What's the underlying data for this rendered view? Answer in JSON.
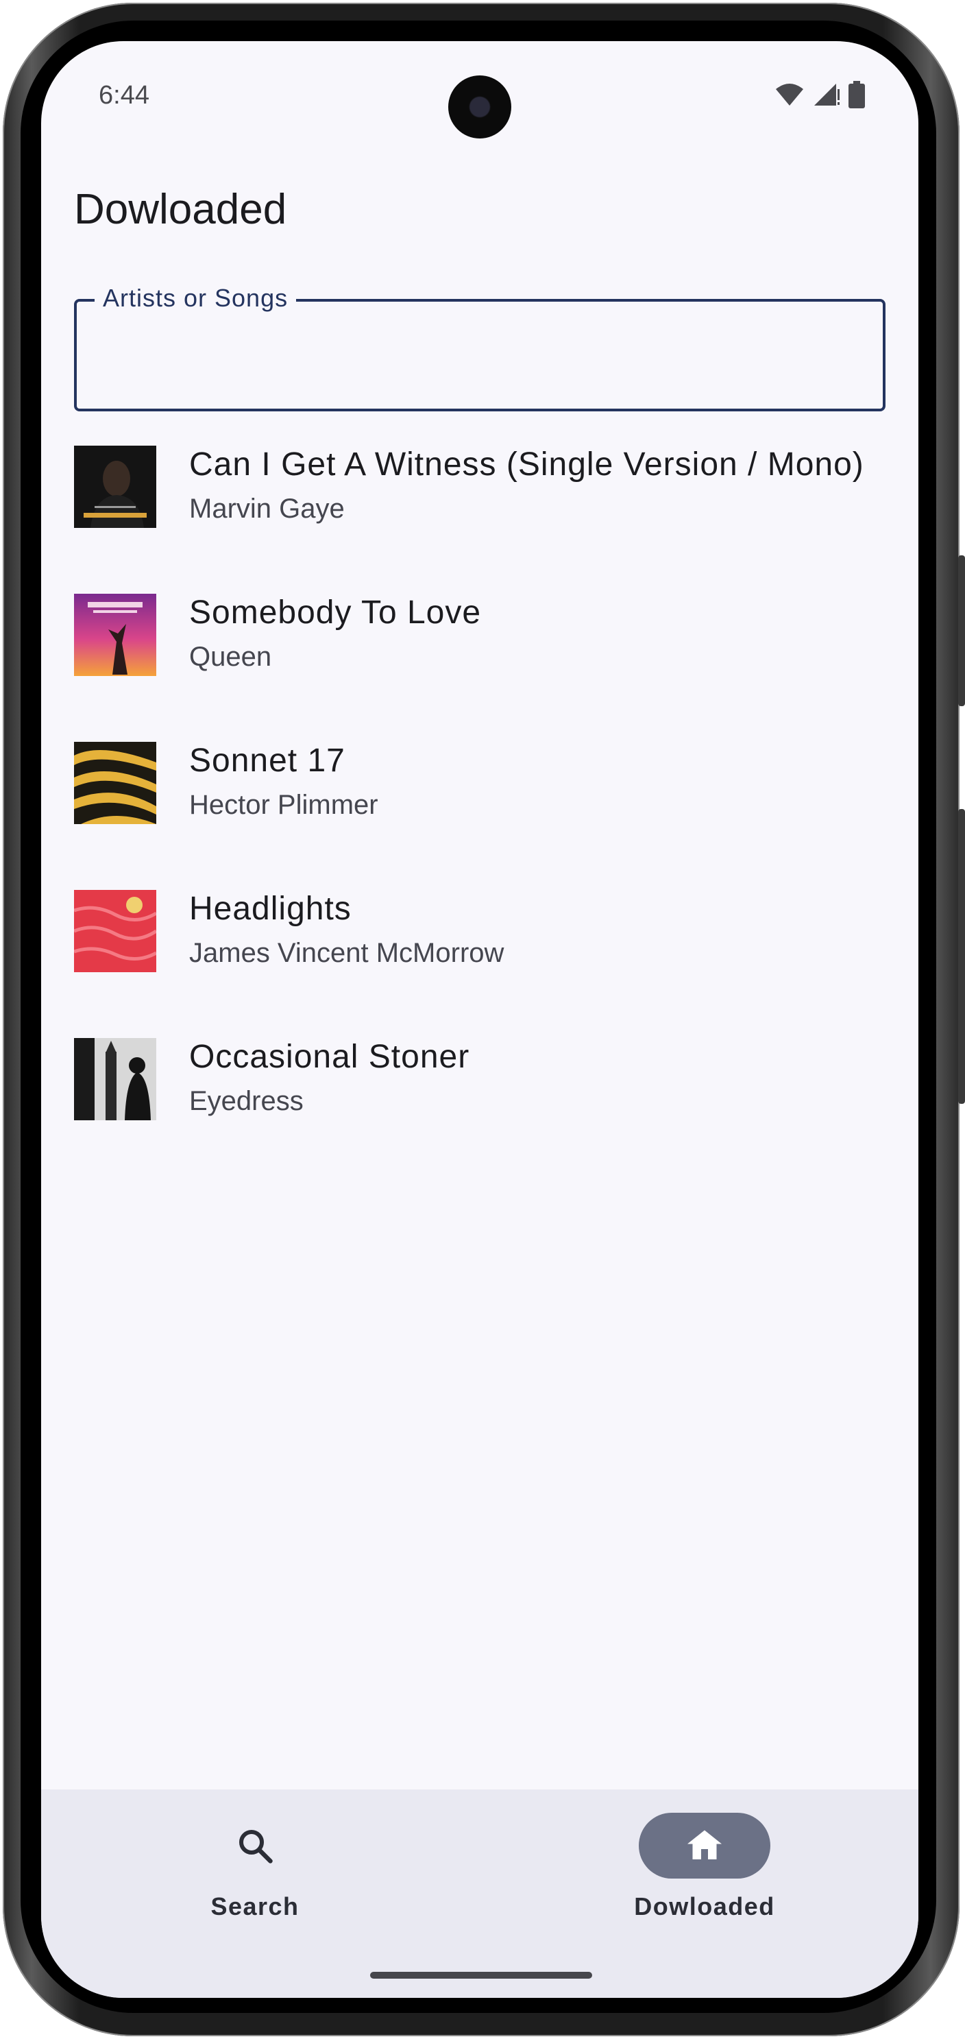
{
  "status_bar": {
    "time": "6:44",
    "icons": [
      "wifi-icon",
      "signal-icon",
      "battery-icon"
    ]
  },
  "header": {
    "title": "Dowloaded"
  },
  "search": {
    "label": "Artists or Songs",
    "value": "",
    "placeholder": ""
  },
  "songs": [
    {
      "title": "Can I Get A Witness (Single Version / Mono)",
      "artist": "Marvin Gaye"
    },
    {
      "title": "Somebody To Love",
      "artist": "Queen"
    },
    {
      "title": "Sonnet 17",
      "artist": "Hector Plimmer"
    },
    {
      "title": "Headlights",
      "artist": "James Vincent McMorrow"
    },
    {
      "title": "Occasional Stoner",
      "artist": "Eyedress"
    }
  ],
  "nav": {
    "items": [
      {
        "label": "Search",
        "icon": "search-icon",
        "active": false
      },
      {
        "label": "Dowloaded",
        "icon": "home-icon",
        "active": true
      }
    ]
  },
  "colors": {
    "accent": "#24345f",
    "background": "#f8f7fc",
    "nav_background": "#e9e9f2",
    "active_indicator": "#6b7186"
  }
}
